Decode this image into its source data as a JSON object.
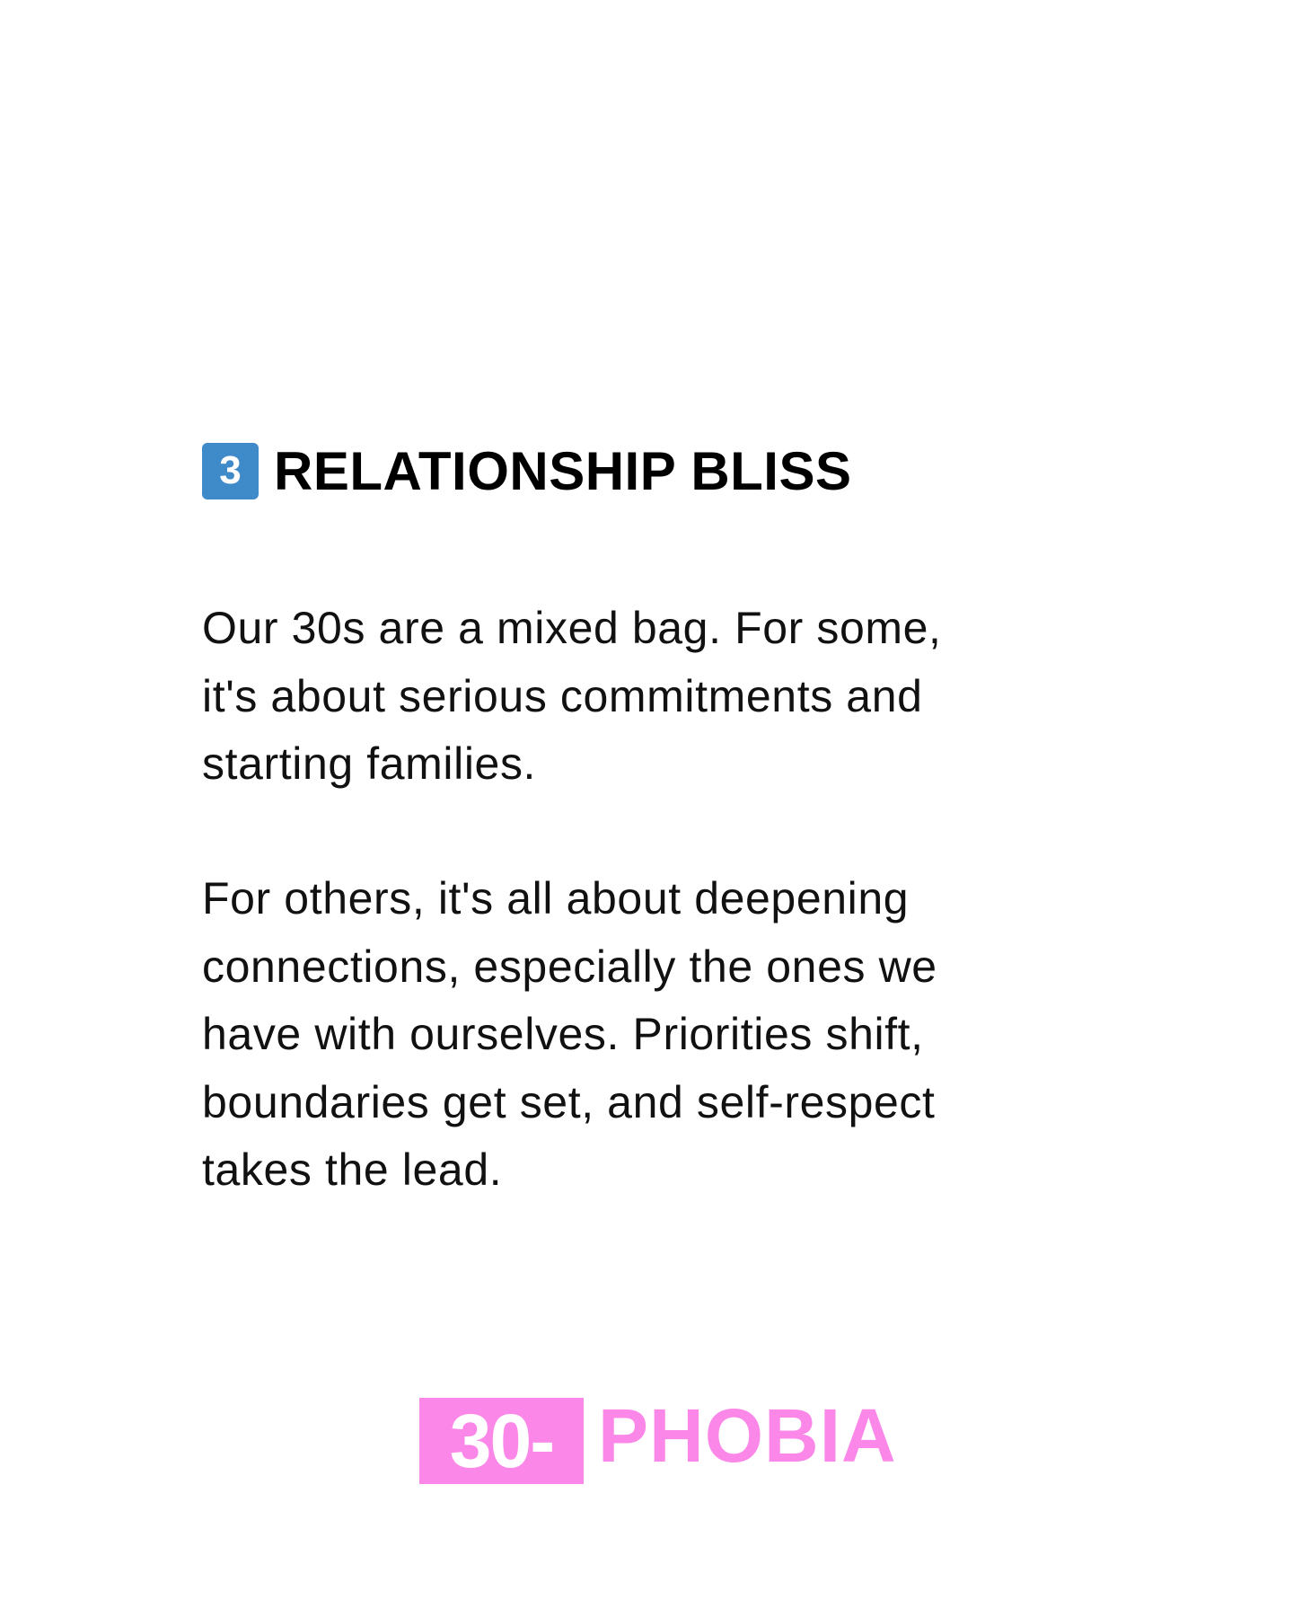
{
  "heading": {
    "number": "3",
    "title": "RELATIONSHIP BLISS",
    "badge_color": "#3f8ac8"
  },
  "paragraphs": [
    "Our 30s are a mixed bag. For some,\nit's about serious commitments and\nstarting families.",
    "For others, it's all about deepening\nconnections, especially the ones we\nhave with ourselves. Priorities shift,\nboundaries get set, and self-respect\ntakes the lead."
  ],
  "logo": {
    "box_text": "30-",
    "text": "PHOBIA",
    "color": "#fb88e8"
  }
}
